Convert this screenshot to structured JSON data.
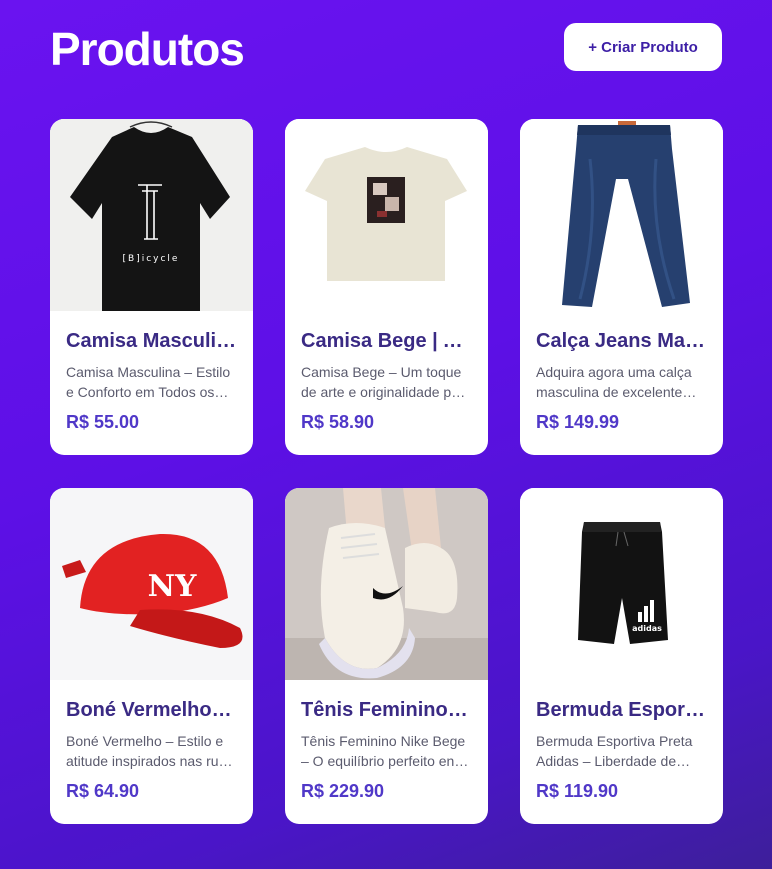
{
  "header": {
    "title": "Produtos",
    "create_button_label": "+ Criar Produto"
  },
  "products": [
    {
      "name": "Camisa Masculina | Bicycle",
      "description": "Camisa Masculina – Estilo e Conforto em Todos os Momentos",
      "price": "R$ 55.00",
      "image_icon": "black-tshirt-bicycle-print"
    },
    {
      "name": "Camisa Bege | Arte",
      "description": "Camisa Bege – Um toque de arte e originalidade para o seu dia",
      "price": "R$ 58.90",
      "image_icon": "beige-tshirt-art-print"
    },
    {
      "name": "Calça Jeans Masculina",
      "description": "Adquira agora uma calça masculina de excelente qualidade",
      "price": "R$ 149.99",
      "image_icon": "blue-jeans"
    },
    {
      "name": "Boné Vermelho NY",
      "description": "Boné Vermelho – Estilo e atitude inspirados nas ruas de Nova York",
      "price": "R$ 64.90",
      "image_icon": "red-cap-ny"
    },
    {
      "name": "Tênis Feminino Nike Bege",
      "description": "Tênis Feminino Nike Bege – O equilíbrio perfeito entre estilo e conforto",
      "price": "R$ 229.90",
      "image_icon": "beige-sneakers"
    },
    {
      "name": "Bermuda Esportiva Preta",
      "description": "Bermuda Esportiva Preta Adidas – Liberdade de movimento",
      "price": "R$ 119.90",
      "image_icon": "black-shorts-adidas"
    }
  ]
}
